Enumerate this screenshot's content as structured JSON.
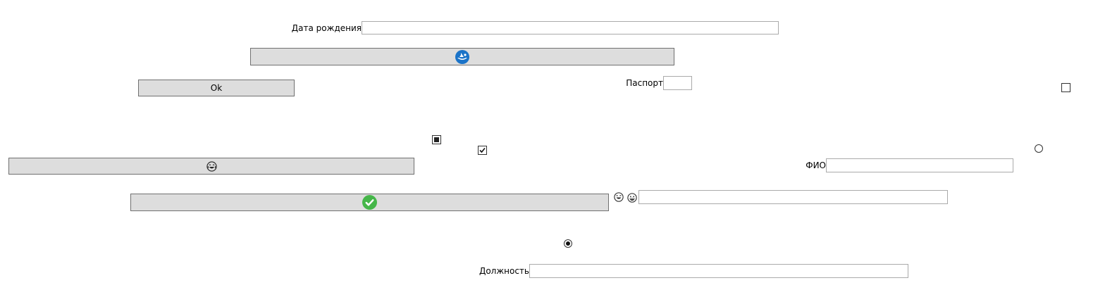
{
  "form": {
    "birth_date_label": "Дата рождения",
    "birth_date_value": "",
    "passport_label": "Паспорт",
    "passport_value": "",
    "fio_label": "ФИО",
    "fio_value": "",
    "position_label": "Должность",
    "position_value": "",
    "emoji_field_value": ""
  },
  "buttons": {
    "ok_label": "Ok",
    "eye_button_icon": "sailboat-icon",
    "laugh_button_icon": "laughing-face-icon",
    "check_button_icon": "green-check-icon"
  },
  "controls": {
    "checkbox_top_right_checked": false,
    "checkbox_indeterminate_state": "indeterminate",
    "checkbox_checked": true,
    "radio_right_checked": false,
    "radio_bottom_checked": true
  },
  "colors": {
    "button_bg": "#dddddd",
    "field_border": "#aaaaaa",
    "accent_blue": "#1a73c8",
    "accent_green": "#45b649"
  }
}
